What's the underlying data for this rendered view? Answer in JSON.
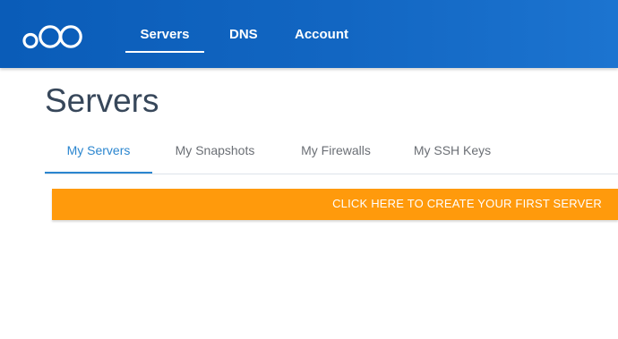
{
  "nav": {
    "logo": "logo-icon",
    "items": [
      {
        "label": "Servers",
        "active": true
      },
      {
        "label": "DNS",
        "active": false
      },
      {
        "label": "Account",
        "active": false
      }
    ]
  },
  "page": {
    "title": "Servers"
  },
  "tabs": [
    {
      "label": "My Servers",
      "active": true
    },
    {
      "label": "My Snapshots",
      "active": false
    },
    {
      "label": "My Firewalls",
      "active": false
    },
    {
      "label": "My SSH Keys",
      "active": false
    }
  ],
  "cta": {
    "label": "CLICK HERE TO CREATE YOUR FIRST SERVER"
  },
  "colors": {
    "header_blue": "#0a5cb8",
    "accent_blue": "#2b86cf",
    "cta_orange": "#ff9a0c",
    "title_text": "#37475a"
  }
}
